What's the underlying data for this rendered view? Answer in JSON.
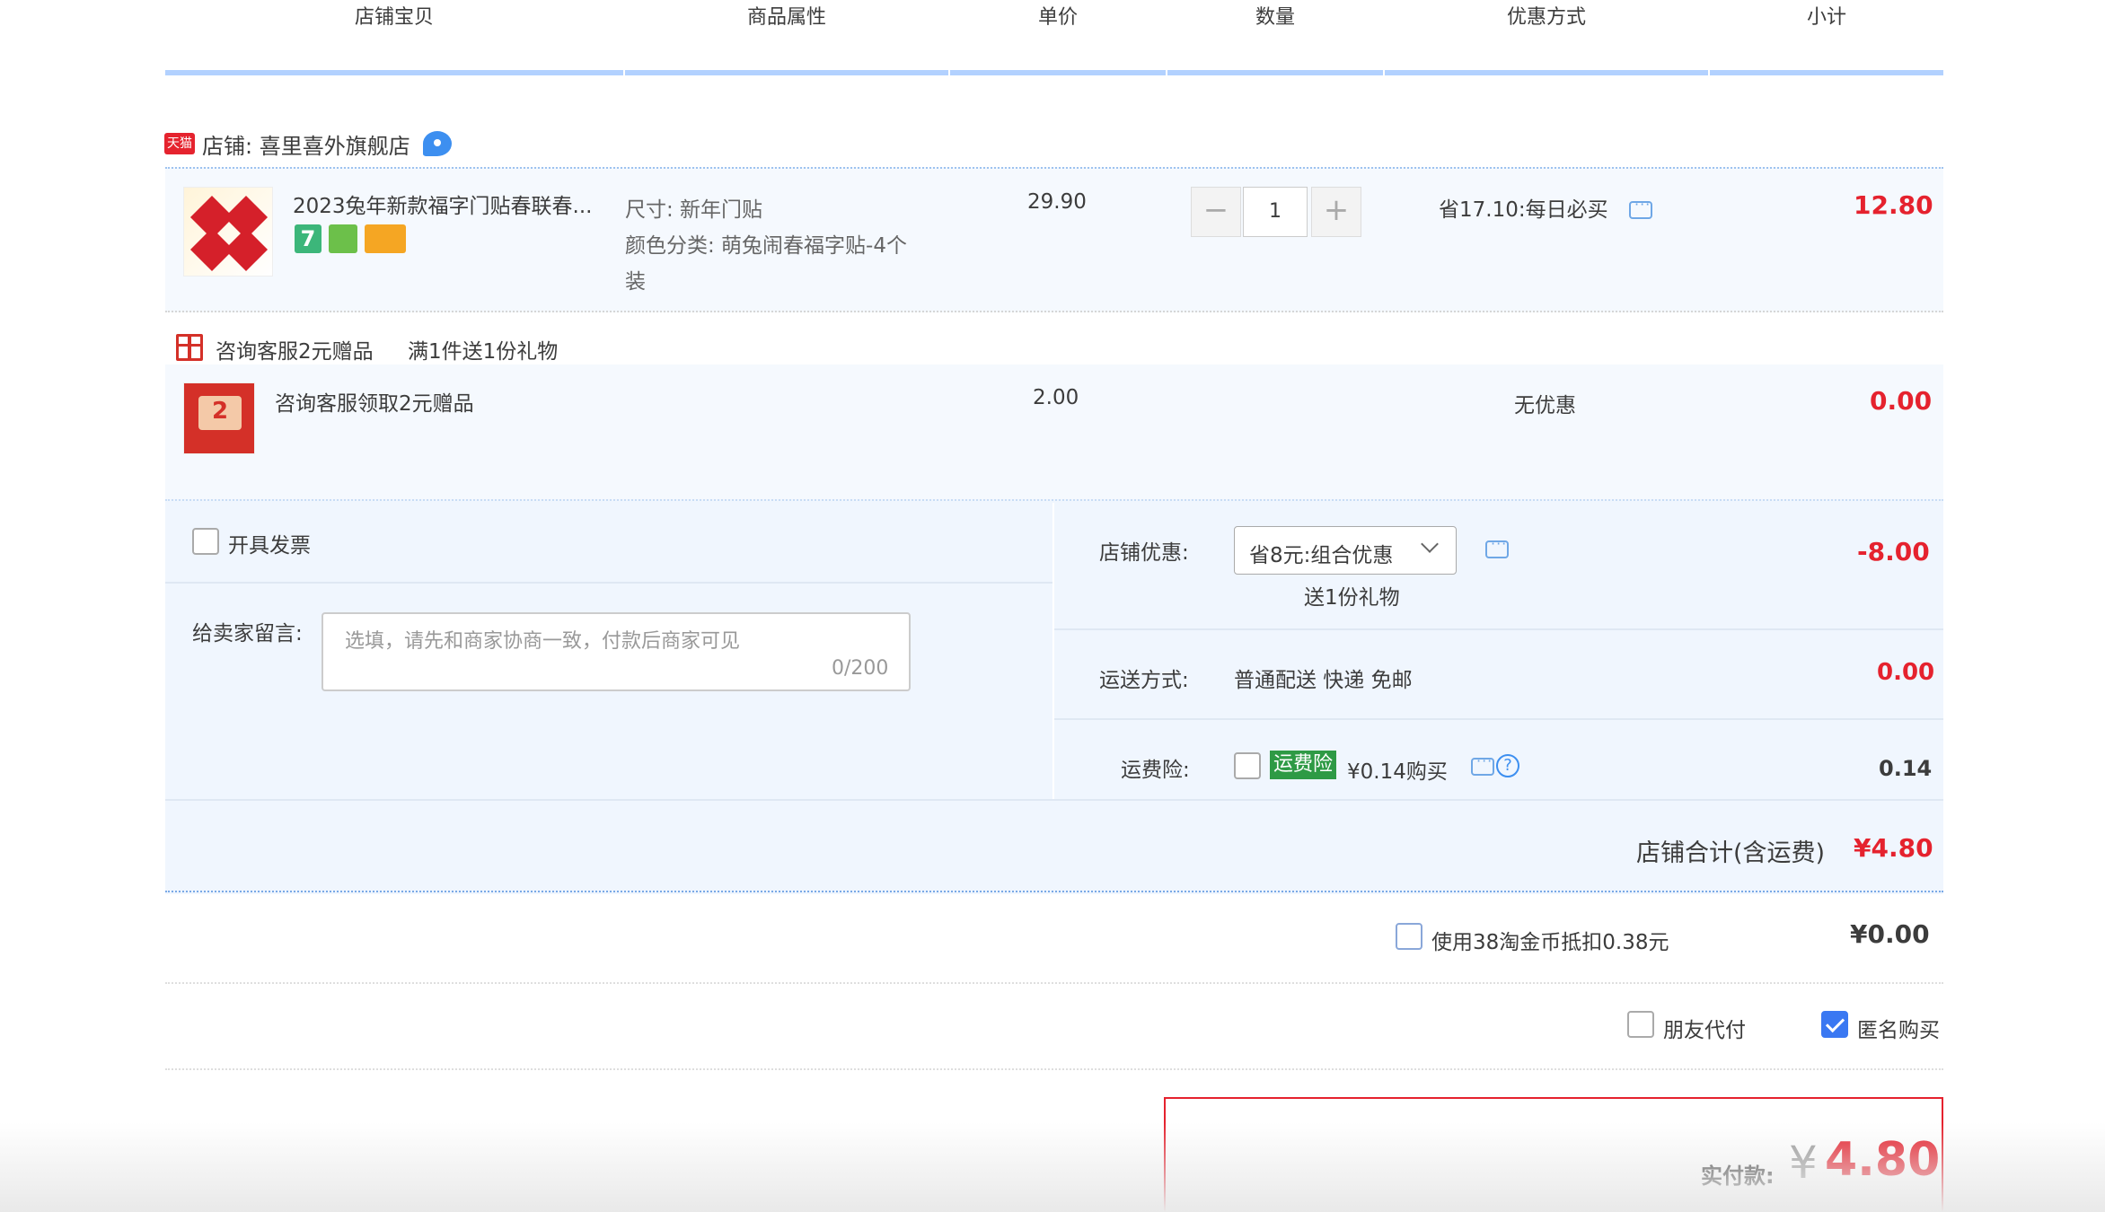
{
  "header": {
    "columns": [
      "店铺宝贝",
      "商品属性",
      "单价",
      "数量",
      "优惠方式",
      "小计"
    ]
  },
  "shop": {
    "badge": "天猫",
    "label": "店铺: 喜里喜外旗舰店",
    "ww_badge": "1"
  },
  "item": {
    "title": "2023兔年新款福字门贴春联春...",
    "attr_size": "尺寸: 新年门贴",
    "attr_color_1": "颜色分类: 萌兔闹春福字贴-4个",
    "attr_color_2": "装",
    "unit_price": "29.90",
    "quantity": "1",
    "qty_minus": "−",
    "qty_plus": "+",
    "discount": "省17.10:每日必买",
    "subtotal": "12.80",
    "tag_colors": [
      "#3cb67a",
      "#6cc04a",
      "#f5a623"
    ],
    "tag_text": "7"
  },
  "gift": {
    "header_left": "咨询客服2元赠品",
    "header_right": "满1件送1份礼物",
    "title": "咨询客服领取2元赠品",
    "thumb_text": "2",
    "unit_price": "2.00",
    "discount": "无优惠",
    "subtotal": "0.00"
  },
  "options": {
    "invoice_label": "开具发票",
    "invoice_checked": false,
    "message_label": "给卖家留言:",
    "message_placeholder": "选填，请先和商家协商一致，付款后商家可见",
    "message_counter": "0/200",
    "shop_discount_label": "店铺优惠:",
    "shop_discount_value": "省8元:组合优惠",
    "shop_discount_gift": "送1份礼物",
    "shop_discount_amount": "-8.00",
    "shipping_label": "运送方式:",
    "shipping_value": "普通配送 快递 免邮",
    "shipping_amount": "0.00",
    "insurance_label": "运费险:",
    "insurance_tag": "运费险",
    "insurance_value": "¥0.14购买",
    "insurance_amount": "0.14",
    "insurance_checked": false
  },
  "totals": {
    "shop_total_label": "店铺合计(含运费)",
    "shop_total_value": "¥4.80",
    "coin_label": "使用38淘金币抵扣0.38元",
    "coin_value": "¥0.00",
    "coin_checked": false,
    "friend_pay_label": "朋友代付",
    "friend_pay_checked": false,
    "anonymous_label": "匿名购买",
    "anonymous_checked": true,
    "pay_label": "实付款:",
    "pay_currency": "¥",
    "pay_value": "4.80"
  },
  "colors": {
    "accent_red": "#e5222e",
    "header_rule": "#b2d1ff",
    "checkbox_blue": "#3a78f2"
  }
}
